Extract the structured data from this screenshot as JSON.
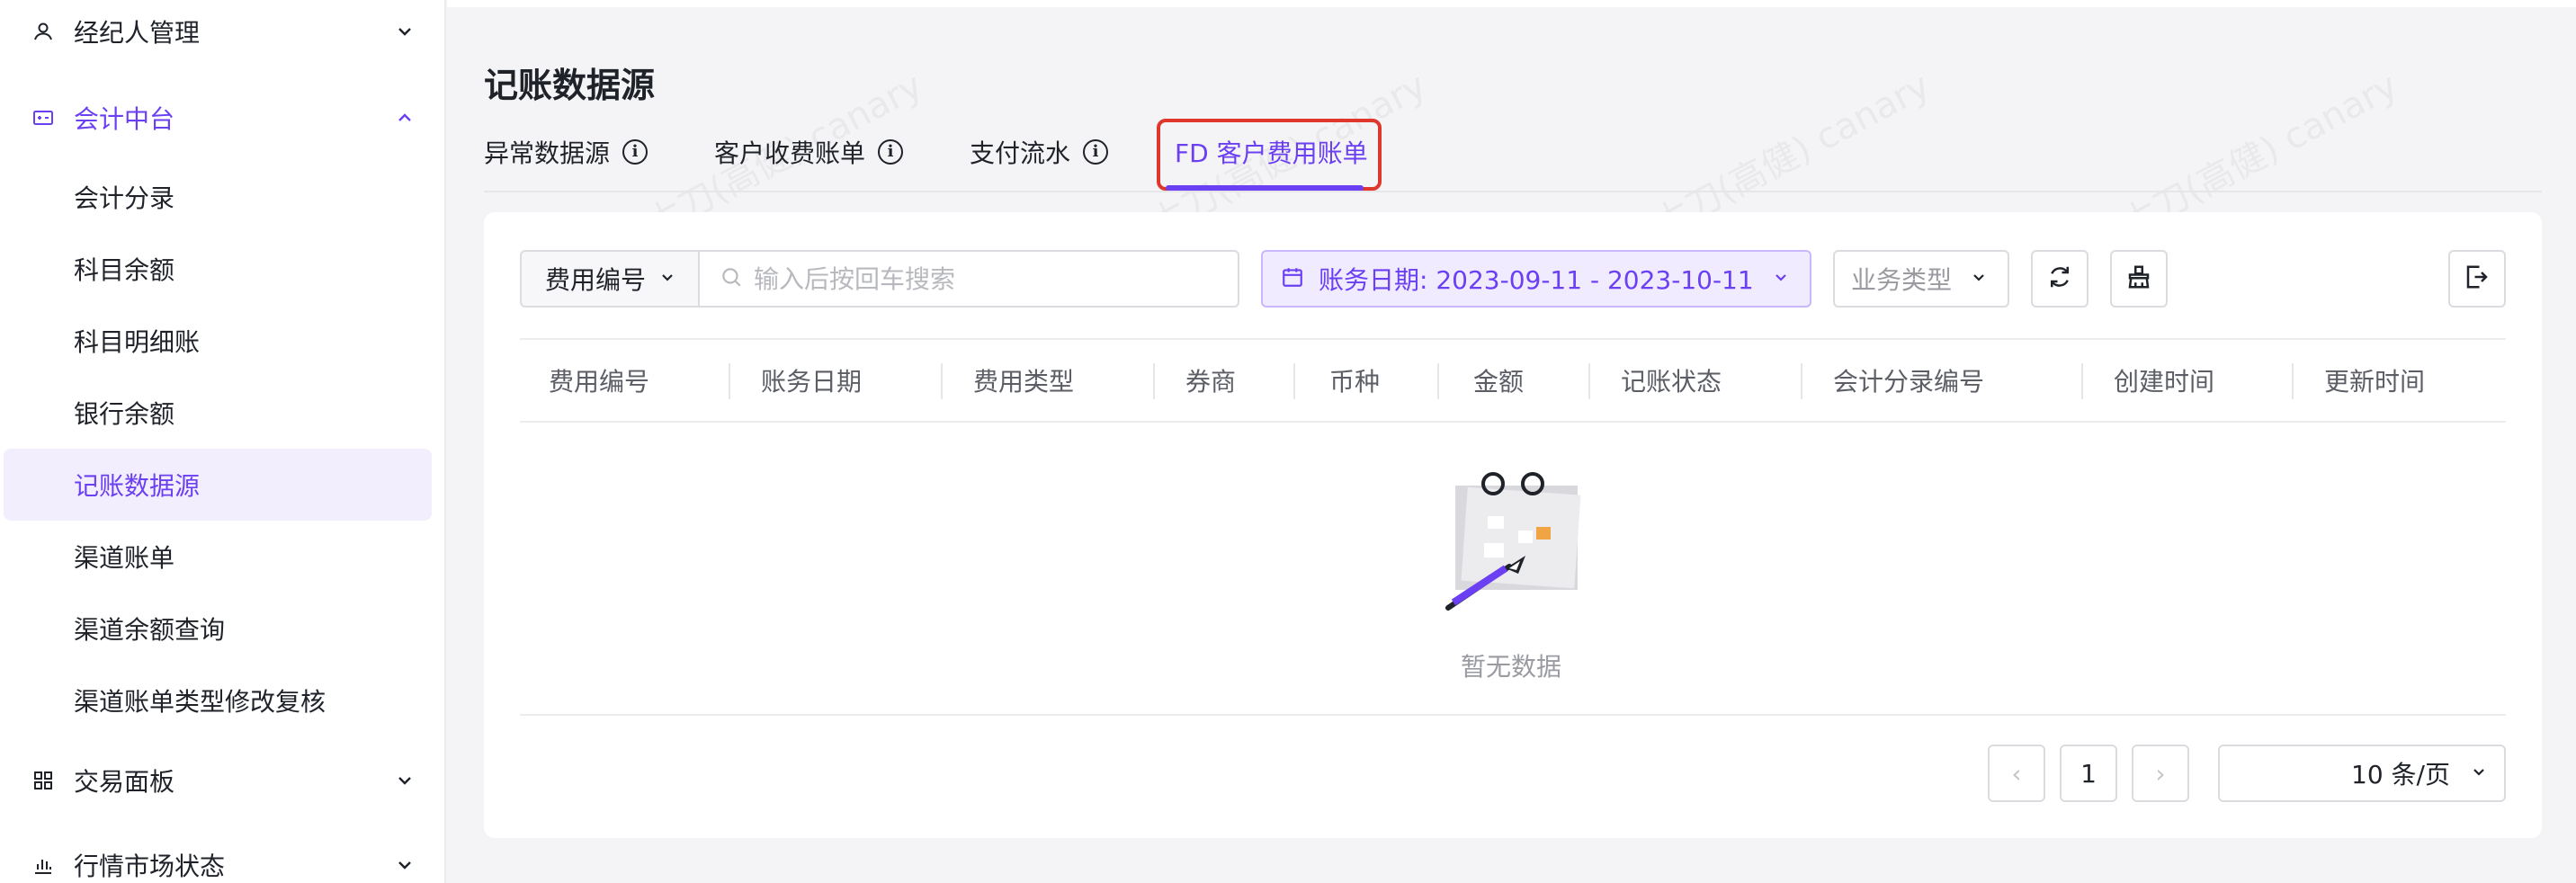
{
  "sidebar": {
    "groups": [
      {
        "label": "经纪人管理"
      },
      {
        "label": "会计中台"
      },
      {
        "label": "交易面板"
      },
      {
        "label": "行情市场状态"
      }
    ],
    "sub_items": [
      {
        "label": "会计分录"
      },
      {
        "label": "科目余额"
      },
      {
        "label": "科目明细账"
      },
      {
        "label": "银行余额"
      },
      {
        "label": "记账数据源"
      },
      {
        "label": "渠道账单"
      },
      {
        "label": "渠道余额查询"
      },
      {
        "label": "渠道账单类型修改复核"
      }
    ]
  },
  "page": {
    "title": "记账数据源",
    "tabs": [
      {
        "label": "异常数据源"
      },
      {
        "label": "客户收费账单"
      },
      {
        "label": "支付流水"
      },
      {
        "label": "FD 客户费用账单"
      }
    ],
    "info_glyph": "i"
  },
  "filters": {
    "field_select": "费用编号",
    "search_placeholder": "输入后按回车搜索",
    "date_range": "账务日期: 2023-09-11 - 2023-10-11",
    "biz_type_placeholder": "业务类型"
  },
  "table": {
    "columns": [
      "费用编号",
      "账务日期",
      "费用类型",
      "券商",
      "币种",
      "金额",
      "记账状态",
      "会计分录编号",
      "创建时间",
      "更新时间"
    ],
    "empty_text": "暂无数据"
  },
  "pagination": {
    "prev": "‹",
    "current_page": "1",
    "next": "›",
    "page_size": "10 条/页"
  },
  "watermark": {
    "text": "木刀(高健) canary"
  },
  "colors": {
    "accent": "#6b3ff2",
    "highlight_border": "#e0372c",
    "selected_bg": "#f3eefe"
  }
}
